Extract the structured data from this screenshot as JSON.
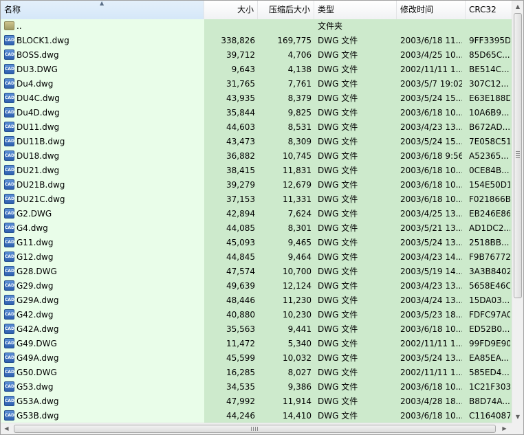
{
  "columns": {
    "name": "名称",
    "size": "大小",
    "packed": "压缩后大小",
    "type": "类型",
    "modified": "修改时间",
    "crc": "CRC32"
  },
  "parent_row": {
    "name": "..",
    "type": "文件夹"
  },
  "files": [
    {
      "name": "BLOCK1.dwg",
      "size": "338,826",
      "packed": "169,775",
      "type": "DWG 文件",
      "modified": "2003/6/18 11...",
      "crc": "9FF3395D"
    },
    {
      "name": "BOSS.dwg",
      "size": "39,712",
      "packed": "4,706",
      "type": "DWG 文件",
      "modified": "2003/4/25 10...",
      "crc": "85D65C..."
    },
    {
      "name": "DU3.DWG",
      "size": "9,643",
      "packed": "4,138",
      "type": "DWG 文件",
      "modified": "2002/11/11 1...",
      "crc": "BE514C..."
    },
    {
      "name": "Du4.dwg",
      "size": "31,765",
      "packed": "7,761",
      "type": "DWG 文件",
      "modified": "2003/5/7 19:02",
      "crc": "307C12..."
    },
    {
      "name": "DU4C.dwg",
      "size": "43,935",
      "packed": "8,379",
      "type": "DWG 文件",
      "modified": "2003/5/24 15...",
      "crc": "E63E188D"
    },
    {
      "name": "Du4D.dwg",
      "size": "35,844",
      "packed": "9,825",
      "type": "DWG 文件",
      "modified": "2003/6/18 10...",
      "crc": "10A6B9..."
    },
    {
      "name": "DU11.dwg",
      "size": "44,603",
      "packed": "8,531",
      "type": "DWG 文件",
      "modified": "2003/4/23 13...",
      "crc": "B672AD..."
    },
    {
      "name": "DU11B.dwg",
      "size": "43,473",
      "packed": "8,309",
      "type": "DWG 文件",
      "modified": "2003/5/24 15...",
      "crc": "7E058C51"
    },
    {
      "name": "DU18.dwg",
      "size": "36,882",
      "packed": "10,745",
      "type": "DWG 文件",
      "modified": "2003/6/18 9:56",
      "crc": "A52365..."
    },
    {
      "name": "DU21.dwg",
      "size": "38,415",
      "packed": "11,831",
      "type": "DWG 文件",
      "modified": "2003/6/18 10...",
      "crc": "0CE84B..."
    },
    {
      "name": "DU21B.dwg",
      "size": "39,279",
      "packed": "12,679",
      "type": "DWG 文件",
      "modified": "2003/6/18 10...",
      "crc": "154E50D1"
    },
    {
      "name": "DU21C.dwg",
      "size": "37,153",
      "packed": "11,331",
      "type": "DWG 文件",
      "modified": "2003/6/18 10...",
      "crc": "F021866B"
    },
    {
      "name": "G2.DWG",
      "size": "42,894",
      "packed": "7,624",
      "type": "DWG 文件",
      "modified": "2003/4/25 13...",
      "crc": "EB246E86"
    },
    {
      "name": "G4.dwg",
      "size": "44,085",
      "packed": "8,301",
      "type": "DWG 文件",
      "modified": "2003/5/21 13...",
      "crc": "AD1DC2..."
    },
    {
      "name": "G11.dwg",
      "size": "45,093",
      "packed": "9,465",
      "type": "DWG 文件",
      "modified": "2003/5/24 13...",
      "crc": "2518BB..."
    },
    {
      "name": "G12.dwg",
      "size": "44,845",
      "packed": "9,464",
      "type": "DWG 文件",
      "modified": "2003/4/23 14...",
      "crc": "F9B76772"
    },
    {
      "name": "G28.DWG",
      "size": "47,574",
      "packed": "10,700",
      "type": "DWG 文件",
      "modified": "2003/5/19 14...",
      "crc": "3A3B8402"
    },
    {
      "name": "G29.dwg",
      "size": "49,639",
      "packed": "12,124",
      "type": "DWG 文件",
      "modified": "2003/4/23 13...",
      "crc": "5658E46C"
    },
    {
      "name": "G29A.dwg",
      "size": "48,446",
      "packed": "11,230",
      "type": "DWG 文件",
      "modified": "2003/4/24 13...",
      "crc": "15DA03..."
    },
    {
      "name": "G42.dwg",
      "size": "40,880",
      "packed": "10,230",
      "type": "DWG 文件",
      "modified": "2003/5/23 18...",
      "crc": "FDFC97A0"
    },
    {
      "name": "G42A.dwg",
      "size": "35,563",
      "packed": "9,441",
      "type": "DWG 文件",
      "modified": "2003/6/18 10...",
      "crc": "ED52B0..."
    },
    {
      "name": "G49.DWG",
      "size": "11,472",
      "packed": "5,340",
      "type": "DWG 文件",
      "modified": "2002/11/11 1...",
      "crc": "99FD9E90"
    },
    {
      "name": "G49A.dwg",
      "size": "45,599",
      "packed": "10,032",
      "type": "DWG 文件",
      "modified": "2003/5/24 13...",
      "crc": "EA85EA..."
    },
    {
      "name": "G50.DWG",
      "size": "16,285",
      "packed": "8,027",
      "type": "DWG 文件",
      "modified": "2002/11/11 1...",
      "crc": "585ED4..."
    },
    {
      "name": "G53.dwg",
      "size": "34,535",
      "packed": "9,386",
      "type": "DWG 文件",
      "modified": "2003/6/18 10...",
      "crc": "1C21F303"
    },
    {
      "name": "G53A.dwg",
      "size": "47,992",
      "packed": "11,914",
      "type": "DWG 文件",
      "modified": "2003/4/28 18...",
      "crc": "B8D74A..."
    },
    {
      "name": "G53B.dwg",
      "size": "44,246",
      "packed": "14,410",
      "type": "DWG 文件",
      "modified": "2003/6/18 10...",
      "crc": "C1164087"
    }
  ],
  "icons": {
    "file": "cad-file-icon",
    "folder": "folder-up-icon",
    "file_icon_text": "CAD"
  },
  "colors": {
    "name_column_bg": "#e9fde9",
    "other_columns_bg": "#cdeacc"
  }
}
